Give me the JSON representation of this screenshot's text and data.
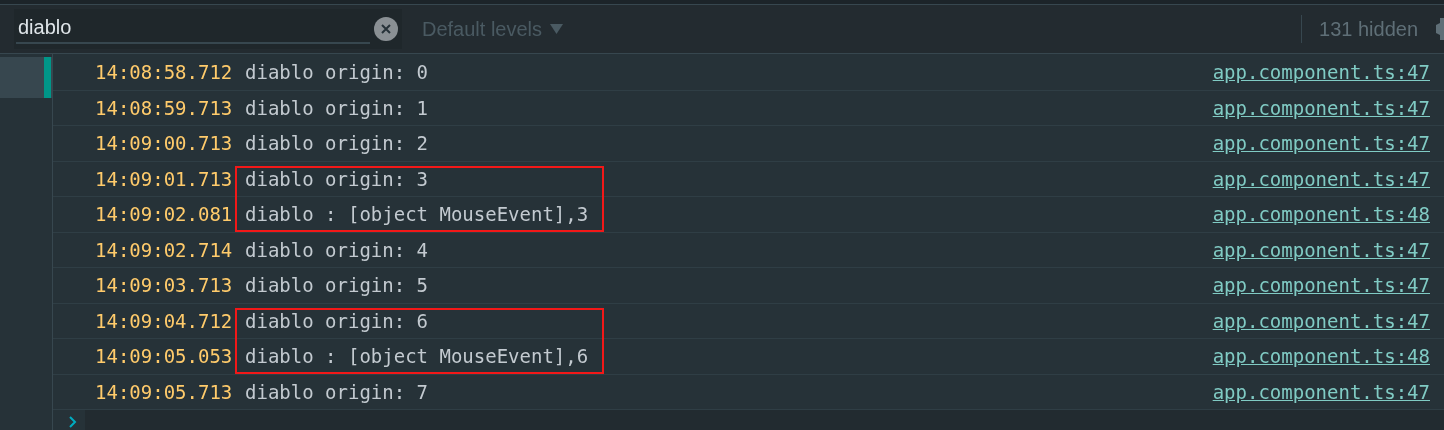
{
  "toolbar": {
    "filter": {
      "value": "diablo"
    },
    "levels_dropdown": {
      "label": "Default levels",
      "disabled": true
    },
    "hidden_count": "131 hidden"
  },
  "sidebar": {
    "items": [
      {
        "selected": true
      }
    ]
  },
  "messages": [
    {
      "time": "14:08:58.712",
      "text": "diablo origin: 0",
      "source": "app.component.ts:47",
      "highlighted": false
    },
    {
      "time": "14:08:59.713",
      "text": "diablo origin: 1",
      "source": "app.component.ts:47",
      "highlighted": false
    },
    {
      "time": "14:09:00.713",
      "text": "diablo origin: 2",
      "source": "app.component.ts:47",
      "highlighted": false
    },
    {
      "time": "14:09:01.713",
      "text": "diablo origin: 3",
      "source": "app.component.ts:47",
      "highlighted": true
    },
    {
      "time": "14:09:02.081",
      "text": "diablo : [object MouseEvent],3",
      "source": "app.component.ts:48",
      "highlighted": true
    },
    {
      "time": "14:09:02.714",
      "text": "diablo origin: 4",
      "source": "app.component.ts:47",
      "highlighted": false
    },
    {
      "time": "14:09:03.713",
      "text": "diablo origin: 5",
      "source": "app.component.ts:47",
      "highlighted": false
    },
    {
      "time": "14:09:04.712",
      "text": "diablo origin: 6",
      "source": "app.component.ts:47",
      "highlighted": true
    },
    {
      "time": "14:09:05.053",
      "text": "diablo : [object MouseEvent],6",
      "source": "app.component.ts:48",
      "highlighted": true
    },
    {
      "time": "14:09:05.713",
      "text": "diablo origin: 7",
      "source": "app.component.ts:47",
      "highlighted": false
    }
  ]
}
